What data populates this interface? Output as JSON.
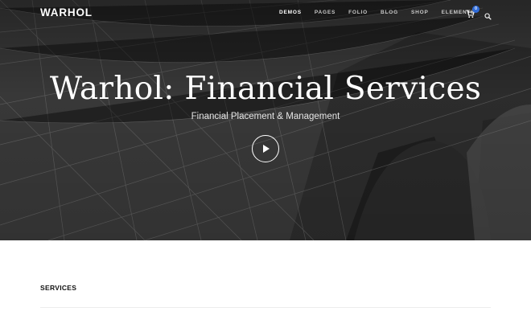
{
  "brand": {
    "logo_text": "WARHOL"
  },
  "nav": {
    "items": [
      {
        "label": "DEMOS",
        "active": true
      },
      {
        "label": "PAGES",
        "active": false
      },
      {
        "label": "FOLIO",
        "active": false
      },
      {
        "label": "BLOG",
        "active": false
      },
      {
        "label": "SHOP",
        "active": false
      },
      {
        "label": "ELEMENTS",
        "active": false
      }
    ],
    "cart_count": "0",
    "icons": [
      "cart-icon",
      "search-icon"
    ]
  },
  "hero": {
    "title": "Warhol: Financial Services",
    "subtitle": "Financial Placement & Management",
    "play_icon": "play-icon"
  },
  "section": {
    "title": "SERVICES"
  },
  "colors": {
    "accent": "#2f6bd8",
    "hero_bg": "#3a3a3a",
    "text_dark": "#111111"
  }
}
